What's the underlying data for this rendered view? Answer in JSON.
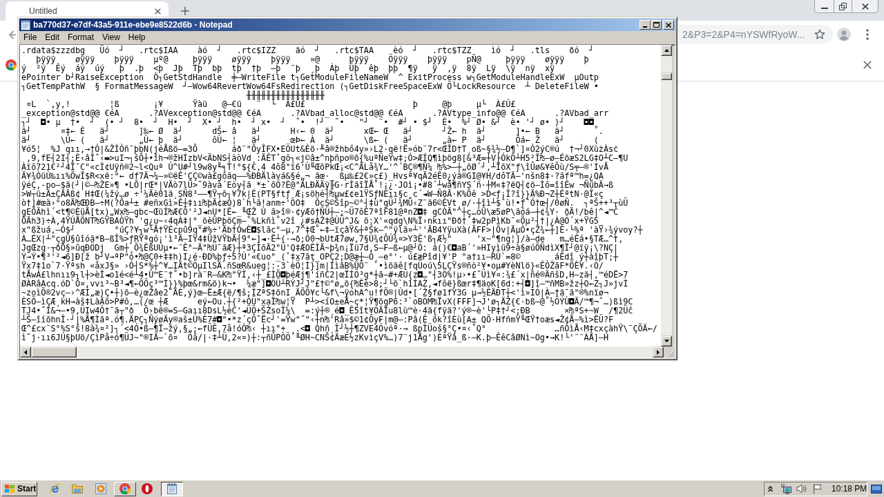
{
  "browser": {
    "tabs": [
      {
        "title": "Untitled",
        "selected": true
      }
    ],
    "address_bar": {
      "value": "2&P3=2&P4=nYSWfRyoW..."
    }
  },
  "notepad": {
    "title": "ba770d37-e7df-43a5-911e-ebe9e8522d6b - Notepad",
    "menu": [
      "File",
      "Edit",
      "Format",
      "View",
      "Help"
    ],
    "lines": [
      ".rdata$zzzdbg   Üó  ┘   .rtc$IAA    àó  ┘   .rtc$IZZ    äó  ┘   .rtc$TAA    èó  ┘   .rtc$TZZ    ìó  ┘   .tls    ðó  ┘",
      "   þÿÿÿ    øÿÿÿ    þÿÿÿ    µº@     þÿÿÿ    øÿÿÿ    þÿÿÿ    »@      þÿÿÿ    Öÿÿÿ    þÿÿÿ    pÑ@     þÿÿÿ    øÿÿÿ    þ",
      "ý  ²ý  Êý  áý  úý   þ  .þ  <þ  Jþ  Tþ  bþ  tþ  †þ  –þ  ¨þ  ¸þ  Àþ  Úþ  êþ  þþ  ¶ÿ   ÿ  ,ÿ  8ÿ  Lÿ  \\ÿ  nÿ  xÿ",
      "ePointer b┘RaiseException  Ò┐GetStdHandle  ╪–WriteFile t┐GetModuleFileNameW  ^ ExitProcess w┐GetModuleHandleExW  µOutp",
      "┐GetTempPathW  § FormatMessageW  ┘–Wow64RevertWow64FsRedirection (┐GetDiskFreeSpaceExW Ö└LockResource  ┴ DeleteFileW •",
      "                                              ╫╫╫╫╫╫╫╫╫╫╫╫╫╫╫╫",
      " ¤L  `,y,!        ¦ß       ¡¥      Ÿàü   @–€ü   ¨  └  À£Ú£                      þ     @þ     µ└  À£Ú£",
      "_exception@std@@ €éA      .?AVexception@std@@ €éA      .?AVbad_alloc@std@@ €éA      .?AVtype_info@@ €éA      .?AVbad_arr",
      "┐┘  ◘• µ  †•  ┘  (• ┘  8•  ┘  H•  ┘  X• ┘  h•  ┘ x•  ┘  ˆ•  !┘  ˜•   \"┘  ¨•  #┘ • $┘  È•  %┘ Ø• &┘  è• '┘ ø• )┘    ◘◘",
      "ä┘      ¤‡← È   ä┘      ]‰← Ø  ä┘      dŠ← â   ä┘      H‹← 0  ä┘      xŒ← Œ   ä┘      ┘Ž← h  ä┘      ]•← B   ä┘      ˚.",
      "ä┘      \\Ú← (   ä┘      „Ù← þ  ä┘      ôÙ← ¦   ä┘      œÞ← À  ä┘      \\ß← (   ä┘      „à← P  ä┘      Ôá← Ž   ä┘      (",
      "¥ó5¦  %J qıı,→†Ó|&ŽÌÒñ¯þbN(jéÅßö–=3Ô       áð¨\"ÔyÎFX•EÖUt&Èö·╨â®žhbő4y»›L2·që!Ë»ób¨7r<ŒÎD†T¸oß~§¾½–D¶`]¤Ò2ýC®ú  †¬┘0XùżÀsċ",
      " ,9,fE┤2I┤;È‹âÎˆ‹▬>uI¬┐šÔ┼•îh¬®žHÍzbV<ÄbNS┤àòVd¸:ÄÊTˆgô┐«j©â±^nþñpo®õ{%uªÑeŸw‡;Ó>ÆÍQ¶ìþög8[&³Æ=┼V├ÓkÔ┴H5²Î₧–ø–ÉöæS2LG‡O┴C–¶U",
      "Àïô721€²┘4Ï¯C\"«cÌ¢Uÿñ®2~l<Quª Ú^U#┘l9w8y╙╕T!°${€,4 4ô8\"ï6'Ù╙ŒõPkŒ¡<C^ÄLå¾Y…'^´BÇ®¶Ñ¼ ₧%>—┼„õØ´┘,┴ÏõX\"ƒ\\îÛø&¥êÕù/S╤–®'IvÅ",
      "Ä¥¾ÒüÙ‰ıı%ÕwÎ$R<xë:°← df7Ä¬¼—»©ëÊ'ÇÇ©wà£gôãq——%ÐBÄlàvá&§é„¬ ãœ·_ ßµ‰£2€»c£)_Hvsª¥qÄ2éÊ0¿ýä®GI@¥H/dôTÄ—'nšn8‡·?ãfª™h=¿QA",
      "ÿéÇ,-po—$ã(┘|©–₧ŽE»¶ •LÕ|rŒ*|VÄò7lÜ>˜9àvà´Eòy┤ã *±`õÖ?È@\"ÄLÐÄÄÿ╟G·rÌãîÏÅ˚!¡¿·JOì¡•#8´┴wâ¶ñYS´ñ·┼M«‡?ëQ┤¢ö–Ìô=îîÊw ¬ÑübÄ→ß",
      ">W┬ü±Ä±ÇÄÄß¢ H‡Œ(¼žý…ø ÷'¼Äè01ä¸SÑ8³——¶Ÿ┬õ┐¥7k|É(PT§ftƒ Æ¡söhé┤₧µw£¢e1ŸSƒNÈıı§c¸c´◄W–Ñ8Ä·K%Ôê >D<ƒ¡Î?î}}Ä%Ð¬Z┼ÉªtN·@Î«ç",
      "ò†]#œà›°o8Ä₧ŒÐB–÷M(?Ôa┴± #eñxGì»Ê┼‡ıı₧þÄ¢æÒ)8`h└ã!anm÷'ÖO‡  ÕcS©Šîp~©°┤‡ù\"gÜ┘¾MÜ‹Z¨ä6©ÊVt¸ø/·┼îì┴$ˆù!•ƒˆÓ†œ┤/0øÑ.  ┐ªŠ++³┬ùÜ",
      "gEÕÄhì´<t¶©ÈüÅ[tx)„Wx₧–gbc~ŒüÍ₧Æ€Ö'²J◄nU*[Ê←_╙ŒŽ Ù ã>î®·¢yÆõ†ÑÜ┼–;~Ü7ôÈ7ªîF81@ªnZ◘‡ gCÒÄ\"^┼ç…òÛ\\æ5øP\\ãóá–┼¢¾Y· ðÄ!/bê|^◄™Ć",
      "ÕÄh3)÷À,4ŸÚÅÕNT₧GŸBAÒŸh´'g¿u~‹4qÀ‡|°_öèÛPþöÇm–˚%Lkñì˚v2î ¿#sÀŽ‡@ÙÜ^J& ö:X'«qdg\\N%Ï›nkıı\"Ðð†´‡w2pPìKb¯«Õµ²┤†|¿À@Ö´x+ŸG5_",
      "x\"ßžuá,–Ó$┘        °úÇ?¥┐w└Å†ŸÈcpû9q\"#%÷'Äb†ÓwÈ◘$lãc°–µ,7^‡Œ˚←‡–ïçâŸ&┼ªŠk–^\"ÿlã¤┴''ÄB4YÿuXà(Ä₣₣>|Õv|ÄµÒ•çŽ¾←┼]È·└%ª 'àŸ›¾ývoy?┼",
      "À…ÉX|┴\"çgÛ§ûîóã*B–ßÎ%>ƒRŸªgó¡'ì³Ä–IŸ4‡ÛžVŸbÄ┤9°←]◄·Ë┴(·→ð;Ó0¬bUtÆ7øw,7§Ù¾¢ÔÚ¾¤>Y3Ê'ß┐Æ½\"     'x~\"¶ng¦]/à–de   m…éÊá•§TÆ…^†,",
      "JgŒzg·┬ðÕ§»ûqÐÖDj  Gm┼¸Õ¾ÊßUÙµ•←¨Ê°–Ä\"₧Ü¯ãÆ}┼ª3ÇÍõÄ2\"Ü'Q‡ÆOÊÌÄ~þ¾n¡Ïü7d,S–₣—ß←µ@┘Ó: á()€◘aB´'»HIyìü9÷à§øúÕÑdìX¶Ï┘@ïÿ¡\\?NÇ|",
      "Ý→Ý•¶³'²◄6]Ð[ž b┘V→ªP\"ó•₧@Ç0+‡‡h)I¿é·ÐD%þƒ÷5?Ù'«€uo\"_(ˆ‡x7ãţ_OPÇ2;D@æ┼–Ò¸–e°'· ú£æPîd|¥'P \"a†ıı–RÙ`=8©       áÊdî ý┼àîþT;┼",
      "Ÿx7‡1o`7·Ÿªsh «åxJ§» ›Ó┤S*%┼^¥…IÄt©ÖµIlSÄ.ñSœR&ueg¦:-3`èÖ¦Í}]m|IìâB%ÛÖ¨ `•ìöäê[fqÜoú\\5LÇŸs®ñò²¥•oµ#YèNlö}«ÊÒŽãF*ÕÊ¥.‹Ö/",
      "tÅwÁ£lhnıı9┐l┼>èÎ◄o1é<é┴4•Û™E¨†˚•b]rà¨R–&K₧\"ŸÎ,‹┼_£ÌÕ◘þéÆj¶'íñC2|œÏÍÖ³g*┼ã–#+ÆU{z◘…\"┤3Ö%!µ›•£˝Üì¥¤:¾£´x|ñé®ÄñšD,H–zä┤,™éDË>7",
      "ØÀRâAcq.óD`Ô¤,vvı³~B³◄¶←ÔÕç³™Ì}}%þœ&rm&ö)k¬•  ¼æ\"]◘ÒÜ┴RÝJ┘J\"£†©\"ø„ö{₧Êè>8;┘└ö`h1ÌAŽ,◄fôë}ßœr‡¶äoK[6d:+┤◘]î–™ñMB»žz┼O←Z┐J»jvÌ",
      "~zoìÕ®2vç–›^ÆÍ„æ)Ç•┼)õ–è¿œŽâe2˜ÄÉ,ý}œ–Ë±Æ{ë/¶š;ÎZªS‡önI_ÄÕÔ¥c└&f\\¬ÿohA^u!fÕ®|Ùd•[´Ž§fø1fY3G µ→½ÊÄÐT┼<'ì»IÓ|À–†ä¯ã\"®%nïø¬",
      "ÈSÕ–ìÇÆ¸kH→àš‡LàÄö>P#ô,…(/œ ┼Æ      eý←Ou.┼{²+ÒÜ\"xaÏ₧w¦Ÿ  P┴><íO±eÅ~ç*¦Ÿ¶ögP6:³`oBÖM₧ÏvX(₣₣₣]¬J'ø┐ÄŽ{€·bß–@˚½ÖÝÙ◘Ä/™¶¬ˆ…)ßì9C",
      "TJ4•ˆÍ&¬–•9,ÜIw4Ó†¯ã┬\"ð  Ô›bë®=S–Gaıı8DsL½èC'◄ÜÖ+ŠŽsoÎ¼\\  =:ý┼®¸é◘_Ê5ît¥ÓÄÌu8lù™è·4ä{fÿä?'ý®~è'└P‡†┘<;ÐB       ×₧ªS+~W  /¶2Üč",
      "┴Š–îíõhnÎ·┘|%Å¶Ìãª.ó¶.ÄPÇ┐ÑýøÄy®aš±Ú%É7#◘\"•*z´çÔˆËc┘'=Ÿw\"˝\"‹┼n₧'Râ»$©1¢Ôy₣|m@–:Pâ(Ê ök?îÈù[A± QÕ·HfñmŸ╙ŒŸ†oæs◄Ž¢Å–%ì>ËÜ?F",
      "Œ^£cx¨S°%S°š!8à¾¤²]┐´<4Ó•ß–¶Ï–žý,§„;←fÜÊ,7å!óÒ₧‹ ┼ıı\"+ ¸.<◘ Qhñ¸Î┘½┼¶ZVE4Óvóª·→ ßpÎÜoš§°Ç•¤‹˚Q°              …ñÔìÅ‹M‡cxçàhŸ\\¯ÇÕÄ←/",
      "ì˜j·ıı6JÚ§þUö/ÇìPå÷ó¶ÜJ~\"®IÄ–`õ¤  Óå/|·‡┴Ü,2«¤)┼:┬ñÛPÒÖ´╙ØH~CNŠ¢ÄæE½zKvìçV%…)7¨j1Åg')ÈªŸâ_ß·–K.þ–ÊêCâØNì~Og•→K!└'¨¨ÀÅ]–H"
    ]
  },
  "taskbar": {
    "start": "Start",
    "tasks": [
      {
        "selected": false
      },
      {
        "selected": true
      }
    ],
    "clock": "10:18 PM"
  }
}
